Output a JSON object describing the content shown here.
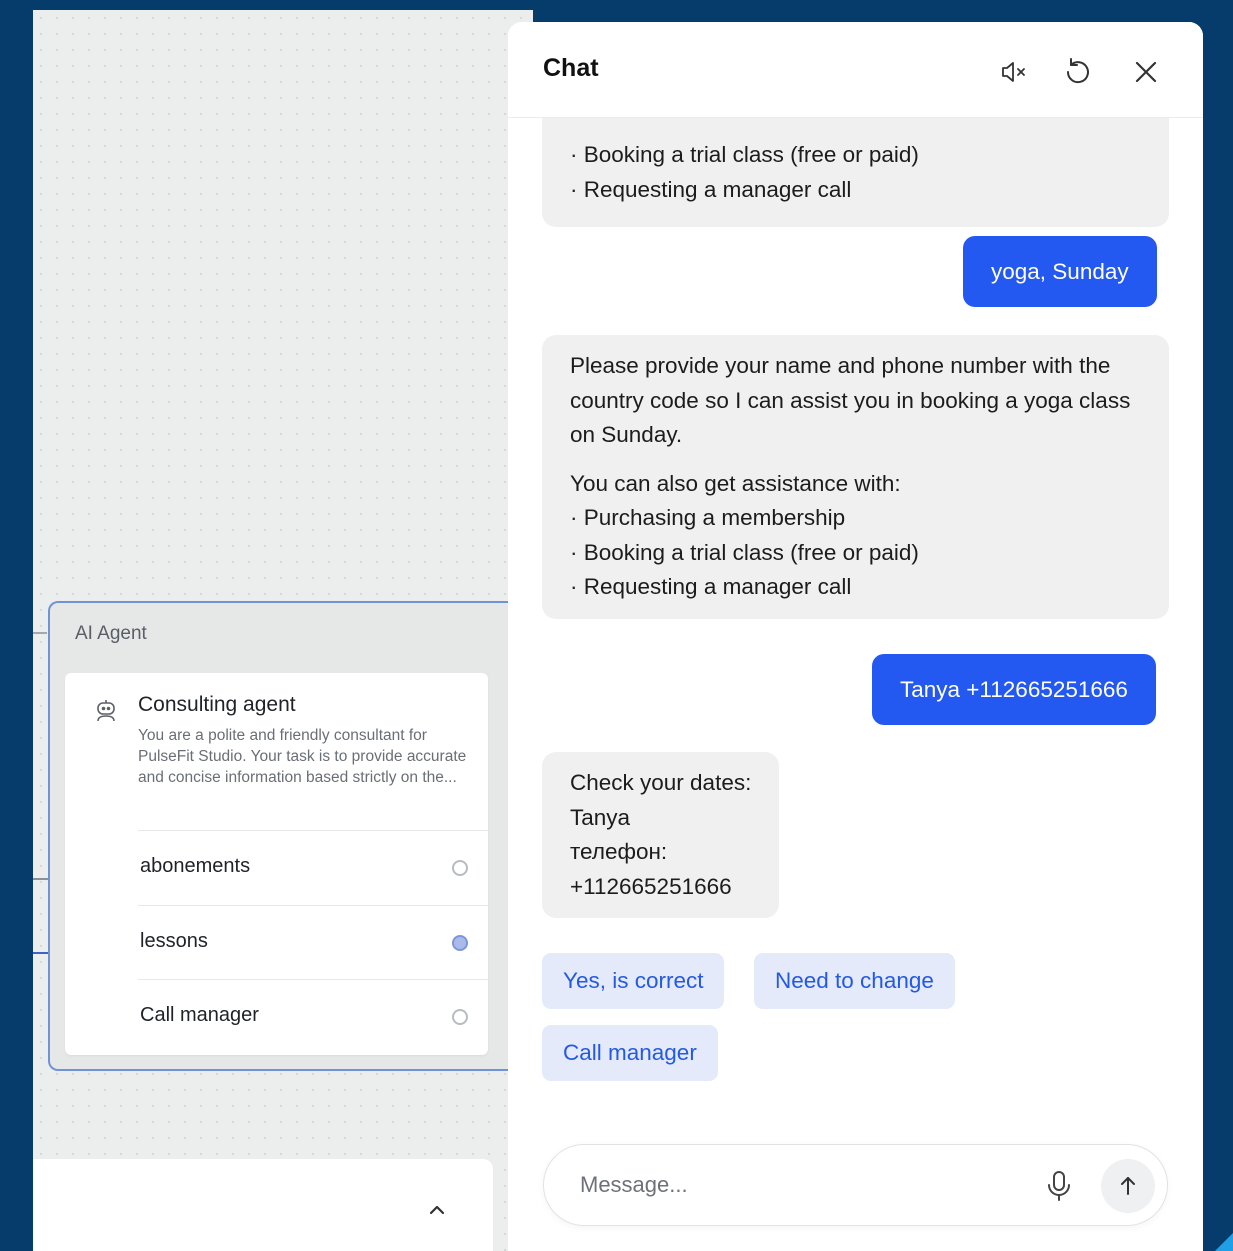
{
  "canvas": {
    "agent_node": {
      "title": "AI Agent",
      "card": {
        "icon": "robot-icon",
        "title": "Consulting agent",
        "description": "You are a polite and friendly consultant for PulseFit Studio. Your task is to provide accurate and concise information based strictly on the...",
        "options": [
          {
            "label": "abonements",
            "active": false
          },
          {
            "label": "lessons",
            "active": true
          },
          {
            "label": "Call manager",
            "active": false
          }
        ]
      }
    },
    "bottom_panel": {
      "icon": "chevron-up-icon"
    }
  },
  "chat": {
    "title": "Chat",
    "header_icons": [
      "speaker-muted-icon",
      "reset-icon",
      "close-icon"
    ],
    "messages": [
      {
        "from": "bot",
        "lines": [
          "· Booking a trial class (free or paid)",
          "· Requesting a manager call"
        ]
      },
      {
        "from": "user",
        "text": "yoga, Sunday"
      },
      {
        "from": "bot",
        "paragraph1": "Please provide your name and phone number with the country code so I can assist you in booking a yoga class on Sunday.",
        "paragraph2_lines": [
          "You can also get assistance with:",
          "· Purchasing a membership",
          "· Booking a trial class (free or paid)",
          "· Requesting a manager call"
        ]
      },
      {
        "from": "user",
        "text": "Tanya +112665251666"
      },
      {
        "from": "bot",
        "lines": [
          "Check your dates:",
          "Tanya",
          "телефон:",
          "+112665251666"
        ]
      }
    ],
    "quick_replies": [
      "Yes, is correct",
      "Need to change",
      "Call manager"
    ],
    "composer": {
      "placeholder": "Message...",
      "mic_icon": "microphone-icon",
      "send_icon": "arrow-up-icon"
    }
  },
  "colors": {
    "background": "#053c6c",
    "user_bubble": "#2358f1",
    "bot_bubble": "#f0f0f1",
    "quick_reply_bg": "#e4eafa",
    "quick_reply_text": "#2459e4",
    "node_border": "#6f93d6"
  }
}
